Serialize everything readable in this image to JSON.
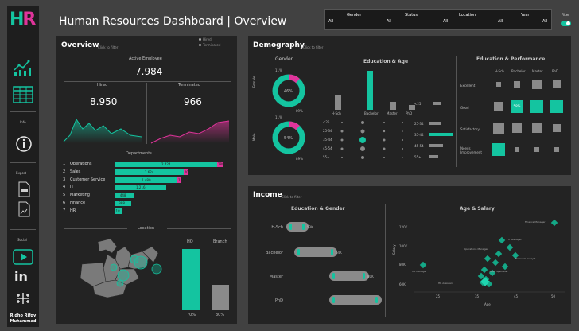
{
  "header": {
    "logo": "HR",
    "title": "Human Resources Dashboard",
    "subtitle": "Overview",
    "filters": [
      {
        "label": "Gender",
        "value": "All"
      },
      {
        "label": "Status",
        "value": "All"
      },
      {
        "label": "Location",
        "value": "All"
      },
      {
        "label": "Year",
        "value": "All"
      }
    ],
    "first_value": "All",
    "filter_toggle_label": "Filter"
  },
  "sidebar": {
    "info_label": "Info",
    "export_label": "Export",
    "social_label": "Social",
    "author": "Ridho Rifqy Muhammad",
    "icons": [
      "line-chart-icon",
      "table-icon",
      "info-icon",
      "pdf-export-icon",
      "image-export-icon",
      "youtube-icon",
      "linkedin-icon",
      "tableau-icon"
    ]
  },
  "overview": {
    "title": "Overview",
    "hint": "Click to filter",
    "legend_hired": "Hired",
    "legend_terminated": "Terminated",
    "active_label": "Active Employee",
    "active_value": "7.984",
    "hired_label": "Hired",
    "hired_value": "8.950",
    "terminated_label": "Terminated",
    "terminated_value": "966",
    "departments_label": "Departments",
    "departments": [
      {
        "rank": "1",
        "name": "Operations",
        "hired": 2424,
        "hired_label": "2.424",
        "terminated": 288,
        "terminated_label": "288"
      },
      {
        "rank": "2",
        "name": "Sales",
        "hired": 1624,
        "hired_label": "1.624",
        "terminated": 201,
        "terminated_label": "201"
      },
      {
        "rank": "3",
        "name": "Customer Service",
        "hired": 1480,
        "hired_label": "1.480",
        "terminated": 184,
        "terminated_label": "184"
      },
      {
        "rank": "4",
        "name": "IT",
        "hired": 1216,
        "hired_label": "1.216",
        "terminated": 0,
        "terminated_label": ""
      },
      {
        "rank": "5",
        "name": "Marketing",
        "hired": 448,
        "hired_label": "448",
        "terminated": 0,
        "terminated_label": ""
      },
      {
        "rank": "6",
        "name": "Finance",
        "hired": 388,
        "hired_label": "388",
        "terminated": 0,
        "terminated_label": ""
      },
      {
        "rank": "7",
        "name": "HR",
        "hired": 118,
        "hired_label": "118",
        "terminated": 0,
        "terminated_label": ""
      }
    ],
    "location_label": "Location",
    "hq_label": "HQ",
    "branch_label": "Branch",
    "hq_pct": "70%",
    "branch_pct": "30%",
    "map_labels": [
      "New York",
      "Illinois",
      "Kentucky",
      "Ohio",
      "Michigan"
    ]
  },
  "demography": {
    "title": "Demography",
    "hint": "Click to filter",
    "gender_title": "Gender",
    "female_label": "Female",
    "male_label": "Male",
    "female_pct": "46%",
    "female_small": "11%",
    "female_outer": "89%",
    "male_pct": "54%",
    "male_small": "11%",
    "male_outer": "89%",
    "edu_age_title": "Education & Age",
    "edu_levels": [
      "H-Sch",
      "Bachelor",
      "Master",
      "PhD"
    ],
    "age_groups": [
      "<25",
      "25-34",
      "35-44",
      "45-54",
      "55+"
    ],
    "edu_perf_title": "Education & Performance",
    "perf_cols": [
      "H-Sch",
      "Bachelor",
      "Master",
      "PhD"
    ],
    "perf_rows": [
      "Excellent",
      "Good",
      "Satisfactory",
      "Needs Improvement"
    ],
    "perf_highlight": "58%"
  },
  "income": {
    "title": "Income",
    "hint": "Click to filter",
    "edu_gender_title": "Education & Gender",
    "edu_rows": [
      {
        "label": "H-Sch",
        "value": "53K"
      },
      {
        "label": "Bachelor",
        "value": "64K"
      },
      {
        "label": "Master",
        "value": "80K"
      },
      {
        "label": "PhD",
        "value": ""
      }
    ],
    "age_salary_title": "Age & Salary",
    "y_ticks": [
      "120K",
      "100K",
      "80K",
      "60K"
    ],
    "x_ticks": [
      "25",
      "35",
      "45",
      "50"
    ],
    "x_label": "Age",
    "y_label": "Salary",
    "role_labels": [
      "Finance Manager",
      "IT Manager",
      "Operations Manager",
      "Financial Analyst",
      "Sales Specialist",
      "HR Manager",
      "HR Assistant"
    ]
  },
  "colors": {
    "teal": "#14c4a0",
    "pink": "#e0349b",
    "panel": "#232323",
    "bg": "#414141"
  }
}
